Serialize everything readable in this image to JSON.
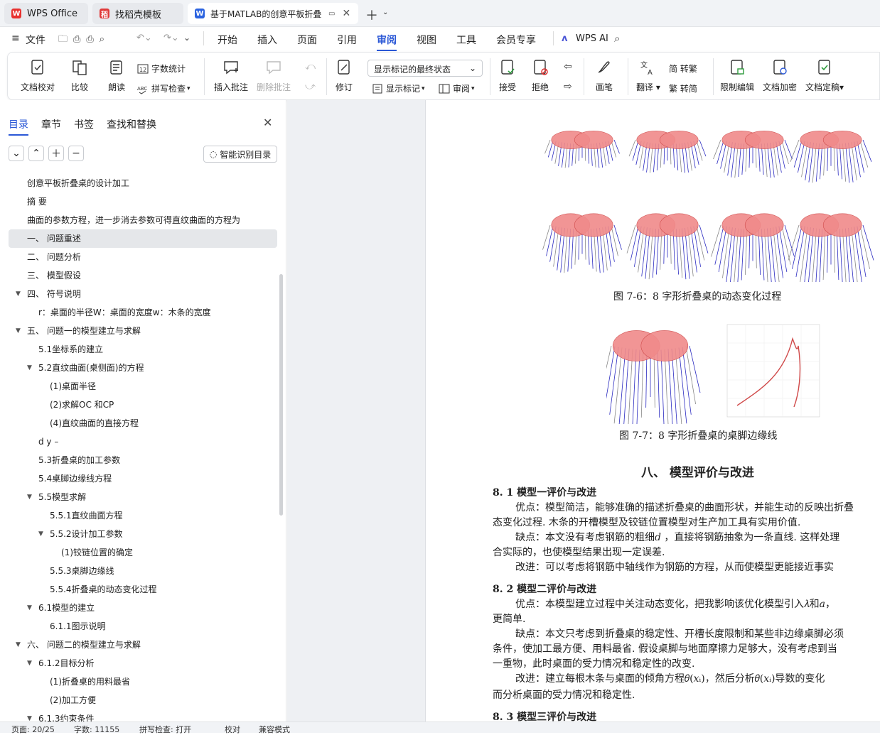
{
  "tabs": [
    {
      "label": "WPS Office",
      "icon": "wps-logo-icon"
    },
    {
      "label": "找稻壳模板",
      "icon": "docer-icon"
    },
    {
      "label": "基于MATLAB的创意平板折叠",
      "icon": "word-doc-icon"
    }
  ],
  "menu": {
    "file": "文件",
    "items": [
      "开始",
      "插入",
      "页面",
      "引用",
      "审阅",
      "视图",
      "工具",
      "会员专享"
    ],
    "active": "审阅",
    "ai": "WPS AI"
  },
  "ribbon": {
    "proof": "文档校对",
    "compare": "比较",
    "read": "朗读",
    "wordcount": "字数统计",
    "spell": "拼写检查",
    "insert_comment": "插入批注",
    "delete_comment": "删除批注",
    "revise": "修订",
    "markup_state": "显示标记的最终状态",
    "show_markup": "显示标记",
    "review": "审阅",
    "accept": "接受",
    "reject": "拒绝",
    "pen": "画笔",
    "translate": "翻译",
    "trad": "简 转繁",
    "simp": "繁 转简",
    "restrict": "限制编辑",
    "encrypt": "文档加密",
    "finalize": "文档定稿"
  },
  "sidebar": {
    "tabs": [
      "目录",
      "章节",
      "书签",
      "查找和替换"
    ],
    "smart_btn": "智能识别目录",
    "toc": [
      {
        "t": "创意平板折叠桌的设计加工",
        "lvl": 0
      },
      {
        "t": "摘 要",
        "lvl": 0
      },
      {
        "t": "曲面的参数方程，进一步消去参数可得直纹曲面的方程为",
        "lvl": 0
      },
      {
        "t": "一、 问题重述",
        "lvl": 0,
        "sel": true
      },
      {
        "t": "二、 问题分析",
        "lvl": 0
      },
      {
        "t": "三、 模型假设",
        "lvl": 0
      },
      {
        "t": "四、 符号说明",
        "lvl": 0,
        "exp": true
      },
      {
        "t": "r：桌面的半径W：桌面的宽度w：木条的宽度",
        "lvl": 1
      },
      {
        "t": "五、 问题一的模型建立与求解",
        "lvl": 0,
        "exp": true
      },
      {
        "t": "5.1坐标系的建立",
        "lvl": 1
      },
      {
        "t": "5.2直纹曲面(桌侧面)的方程",
        "lvl": 1,
        "exp": true
      },
      {
        "t": "(1)桌面半径",
        "lvl": 2
      },
      {
        "t": "(2)求解OC 和CP",
        "lvl": 2
      },
      {
        "t": "(4)直纹曲面的直接方程",
        "lvl": 2
      },
      {
        "t": "d y –",
        "lvl": 1
      },
      {
        "t": "5.3折叠桌的加工参数",
        "lvl": 1
      },
      {
        "t": "5.4桌脚边缘线方程",
        "lvl": 1
      },
      {
        "t": "5.5模型求解",
        "lvl": 1,
        "exp": true
      },
      {
        "t": "5.5.1直纹曲面方程",
        "lvl": 2
      },
      {
        "t": "5.5.2设计加工参数",
        "lvl": 2,
        "exp": true
      },
      {
        "t": "(1)铰链位置的确定",
        "lvl": 3
      },
      {
        "t": "5.5.3桌脚边缘线",
        "lvl": 2
      },
      {
        "t": "5.5.4折叠桌的动态变化过程",
        "lvl": 2
      },
      {
        "t": "6.1模型的建立",
        "lvl": 1,
        "exp": true
      },
      {
        "t": "6.1.1图示说明",
        "lvl": 2
      },
      {
        "t": "六、 问题二的模型建立与求解",
        "lvl": 0,
        "exp": true
      },
      {
        "t": "6.1.2目标分析",
        "lvl": 1,
        "exp": true
      },
      {
        "t": "(1)折叠桌的用料最省",
        "lvl": 2
      },
      {
        "t": "(2)加工方便",
        "lvl": 2
      },
      {
        "t": "6.1.3约束条件",
        "lvl": 1,
        "exp": true
      }
    ]
  },
  "doc": {
    "cap1": "图  7-6：8 字形折叠桌的动态变化过程",
    "cap2": "图  7-7：8 字形折叠桌的桌脚边缘线",
    "h2": "八、 模型评价与改进",
    "s81": "8. 1  模型一评价与改进",
    "p1a": "优点：模型简洁，能够准确的描述折叠桌的曲面形状，并能生动的反映出折叠",
    "p1b": "态变化过程. 木条的开槽模型及铰链位置模型对生产加工具有实用价值.",
    "p2a": "缺点：本文没有考虑钢筋的粗细𝑑 ，直接将钢筋抽象为一条直线. 这样处理",
    "p2b": "合实际的，也使模型结果出现一定误差.",
    "p3a": "改进：可以考虑将钢筋中轴线作为钢筋的方程，从而使模型更能接近事实",
    "s82": "8. 2  模型二评价与改进",
    "p4a": "优点：本模型建立过程中关注动态变化，把我影响该优化模型引入𝜆和𝑎，",
    "p4b": "更简单.",
    "p5a": "缺点：本文只考虑到折叠桌的稳定性、开槽长度限制和某些非边缘桌脚必须",
    "p5b": "条件，使加工最方便、用料最省. 假设桌脚与地面摩擦力足够大，没有考虑到当",
    "p5c": "一重物，此时桌面的受力情况和稳定性的改变.",
    "p6a": "改进：建立每根木条与桌面的倾角方程𝜃(𝑥ᵢ)，然后分析𝜃(𝑥ᵢ)导数的变化",
    "p6b": "而分析桌面的受力情况和稳定性.",
    "s83": "8. 3  模型三评价与改进"
  },
  "status": {
    "page": "页面: 20/25",
    "words": "字数: 11155",
    "spell": "拼写检查: 打开",
    "proof": "校对",
    "compat": "兼容模式"
  },
  "colors": {
    "accent": "#2b58d6",
    "tabbar": "#f1f3f6",
    "doc_bg": "#eef0f3",
    "plot_fill": "#f08a8a",
    "plot_lines": "#2a2ac0"
  }
}
